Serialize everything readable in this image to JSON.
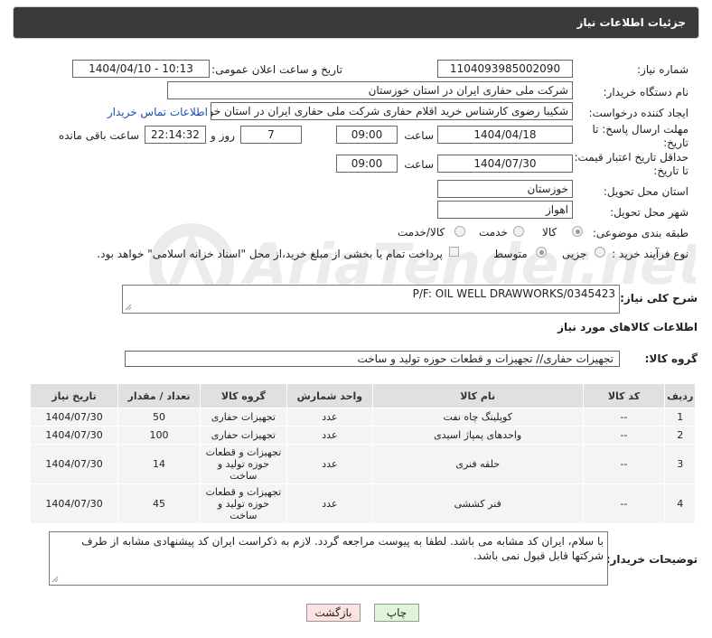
{
  "page": {
    "title": "جزئیات اطلاعات نیاز"
  },
  "fields": {
    "need_number": {
      "label": "شماره نیاز:",
      "value": "1104093985002090"
    },
    "announce_datetime": {
      "label": "تاریخ و ساعت اعلان عمومی:",
      "value": "1404/04/10 - 10:13"
    },
    "buyer_org": {
      "label": "نام دستگاه خریدار:",
      "value": "شرکت ملی حفاری ایران در استان خوزستان"
    },
    "requester": {
      "label": "ایجاد کننده درخواست:",
      "value": "شکیبا رضوی کارشناس خرید اقلام حفاری شرکت ملی حفاری ایران در استان خو",
      "contact_link": "اطلاعات تماس خریدار"
    },
    "reply_deadline": {
      "label": "مهلت ارسال پاسخ: تا تاریخ:",
      "date": "1404/04/18",
      "time_label": "ساعت",
      "time": "09:00",
      "days": "7",
      "days_label": "روز و",
      "remaining": "22:14:32",
      "remaining_label": "ساعت باقی مانده"
    },
    "price_validity": {
      "label": "حداقل تاریخ اعتبار قیمت: تا تاریخ:",
      "date": "1404/07/30",
      "time_label": "ساعت",
      "time": "09:00"
    },
    "delivery_province": {
      "label": "استان محل تحویل:",
      "value": "خوزستان"
    },
    "delivery_city": {
      "label": "شهر محل تحویل:",
      "value": "اهواز"
    },
    "category": {
      "label": "طبقه بندی موضوعی:",
      "options": [
        "کالا",
        "خدمت",
        "کالا/خدمت"
      ],
      "selected": "کالا"
    },
    "purchase_type": {
      "label": "نوع فرآیند خرید :",
      "options": [
        "جزیی",
        "متوسط"
      ],
      "selected": "متوسط",
      "note": "پرداخت تمام یا بخشی از مبلغ خرید،از محل \"اسناد خزانه اسلامی\" خواهد بود."
    }
  },
  "description": {
    "label": "شرح کلی نیاز:",
    "value": "P/F: OIL WELL DRAWWORKS/0345423"
  },
  "items_section": {
    "title": "اطلاعات کالاهای مورد نیاز"
  },
  "goods_group": {
    "label": "گروه کالا:",
    "value": "تجهیزات حفاری// تجهیزات و قطعات حوزه تولید و ساخت"
  },
  "table": {
    "headers": [
      "ردیف",
      "کد کالا",
      "نام کالا",
      "واحد شمارش",
      "گروه کالا",
      "تعداد / مقدار",
      "تاریخ نیاز"
    ],
    "rows": [
      [
        "1",
        "--",
        "کوپلینگ چاه نفت",
        "عدد",
        "تجهیزات حفاری",
        "50",
        "1404/07/30"
      ],
      [
        "2",
        "--",
        "واحدهای پمپاژ اسیدی",
        "عدد",
        "تجهیزات حفاری",
        "100",
        "1404/07/30"
      ],
      [
        "3",
        "--",
        "حلقه فنری",
        "عدد",
        "تجهیزات و قطعات حوزه تولید و ساخت",
        "14",
        "1404/07/30"
      ],
      [
        "4",
        "--",
        "فنر کششی",
        "عدد",
        "تجهیزات و قطعات حوزه تولید و ساخت",
        "45",
        "1404/07/30"
      ]
    ]
  },
  "buyer_notes": {
    "label": "توضیحات خریدار:",
    "value": "با سلام، ایران کد مشابه می باشد. لطفا به پیوست مراجعه گردد. لازم به ذکراست ایران کد پیشنهادی مشابه از طرف شرکتها قابل قبول نمی باشد."
  },
  "buttons": {
    "print": "چاپ",
    "back": "بازگشت"
  },
  "colors": {
    "header_bg": "#3a3a3a",
    "print_bg": "#dff5d8",
    "back_bg": "#fde2e2",
    "link": "#1a4fb0"
  },
  "watermark": {
    "text": "AriaTender.net"
  }
}
